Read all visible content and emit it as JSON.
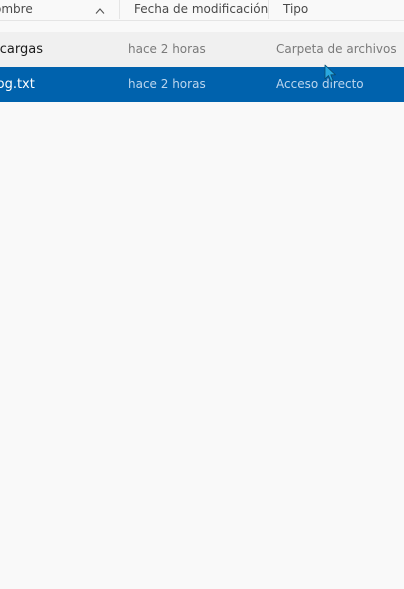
{
  "columns": {
    "name": "ombre",
    "modified": "Fecha de modificación",
    "type": "Tipo"
  },
  "rows": [
    {
      "name": "scargas",
      "modified": "hace 2 horas",
      "type": "Carpeta de archivos",
      "selected": false
    },
    {
      "name": "log.txt",
      "modified": "hace 2 horas",
      "type": "Acceso directo",
      "selected": true
    }
  ],
  "colors": {
    "background": "#f9f9f9",
    "hover_row": "#f0f0f0",
    "selected_row": "#0062ad",
    "cursor": "#29a8e0"
  },
  "icons": {
    "sort": "chevron-up-icon",
    "pointer": "mouse-pointer-icon"
  }
}
